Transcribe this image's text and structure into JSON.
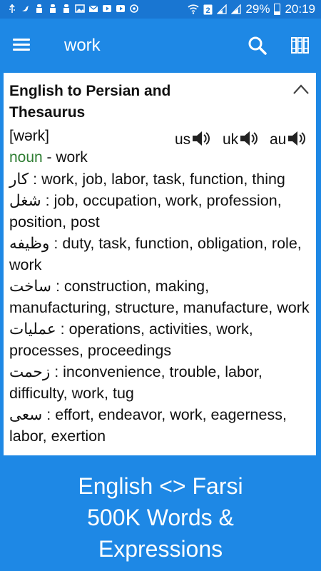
{
  "status_bar": {
    "icons": [
      "usb-icon",
      "bird-icon",
      "cap-icon",
      "cap-icon",
      "cap-icon",
      "image-icon",
      "mail-icon",
      "play-icon",
      "play-icon",
      "sync-icon"
    ],
    "battery": "29%",
    "time": "20:19"
  },
  "app_bar": {
    "query": "work",
    "menu_icon": "menu-icon",
    "search_icon": "search-icon",
    "library_icon": "books-icon"
  },
  "card": {
    "title": "English to Persian and Thesaurus",
    "phonetic": "[wərk]",
    "pos": "noun",
    "pos_rest": " - work",
    "pronunciations": [
      {
        "label": "us",
        "icon": "speaker-icon"
      },
      {
        "label": "uk",
        "icon": "speaker-icon"
      },
      {
        "label": "au",
        "icon": "speaker-icon"
      }
    ],
    "definitions": [
      {
        "fa": "کار",
        "en": "work, job, labor, task, function, thing"
      },
      {
        "fa": "شغل",
        "en": "job, occupation, work, profession, position, post"
      },
      {
        "fa": "وظیفه",
        "en": "duty, task, function, obligation, role, work"
      },
      {
        "fa": "ساخت",
        "en": "construction, making, manufacturing, structure, manufacture, work"
      },
      {
        "fa": "عملیات",
        "en": "operations, activities, work, processes, proceedings"
      },
      {
        "fa": "زحمت",
        "en": "inconvenience, trouble, labor, difficulty, work, tug"
      },
      {
        "fa": "سعی",
        "en": "effort, endeavor, work, eagerness, labor, exertion"
      }
    ]
  },
  "promo": {
    "line1": "English <> Farsi",
    "line2": "500K Words &",
    "line3": "Expressions"
  },
  "colors": {
    "primary": "#1e88e5",
    "status_bar": "#1976d2",
    "pos_green": "#2e7d32"
  }
}
